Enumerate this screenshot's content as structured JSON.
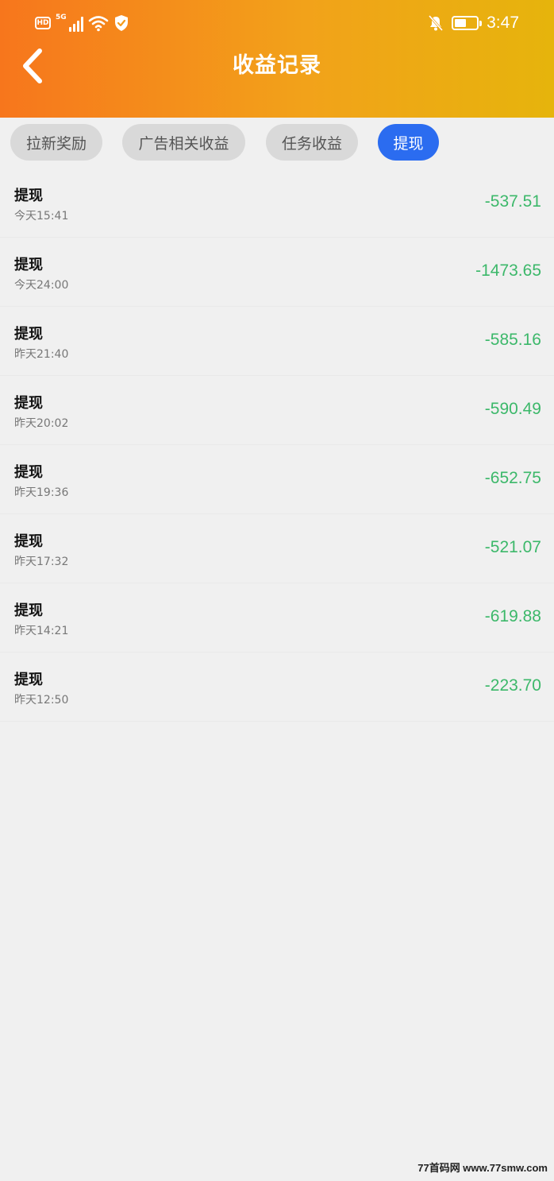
{
  "status_bar": {
    "hd_label": "HD",
    "network_label": "5G",
    "time": "3:47",
    "battery_level": 0.55,
    "icons": [
      "hd-icon",
      "signal-icon",
      "wifi-icon",
      "shield-check-icon",
      "mute-bell-icon",
      "battery-icon"
    ]
  },
  "header": {
    "title": "收益记录",
    "back_icon": "chevron-left-icon",
    "gradient_colors": [
      "#f7761c",
      "#f2a21a",
      "#e6b40c"
    ]
  },
  "tabs": [
    {
      "label": "拉新奖励",
      "active": false
    },
    {
      "label": "广告相关收益",
      "active": false
    },
    {
      "label": "任务收益",
      "active": false
    },
    {
      "label": "提现",
      "active": true
    }
  ],
  "records": [
    {
      "label": "提现",
      "time": "今天15:41",
      "amount": "-537.51"
    },
    {
      "label": "提现",
      "time": "今天24:00",
      "amount": "-1473.65"
    },
    {
      "label": "提现",
      "time": "昨天21:40",
      "amount": "-585.16"
    },
    {
      "label": "提现",
      "time": "昨天20:02",
      "amount": "-590.49"
    },
    {
      "label": "提现",
      "time": "昨天19:36",
      "amount": "-652.75"
    },
    {
      "label": "提现",
      "time": "昨天17:32",
      "amount": "-521.07"
    },
    {
      "label": "提现",
      "time": "昨天14:21",
      "amount": "-619.88"
    },
    {
      "label": "提现",
      "time": "昨天12:50",
      "amount": "-223.70"
    }
  ],
  "colors": {
    "active_tab": "#2b6cf0",
    "amount": "#3cb86a",
    "background": "#f0f0f0"
  },
  "watermark": "77首码网 www.77smw.com"
}
